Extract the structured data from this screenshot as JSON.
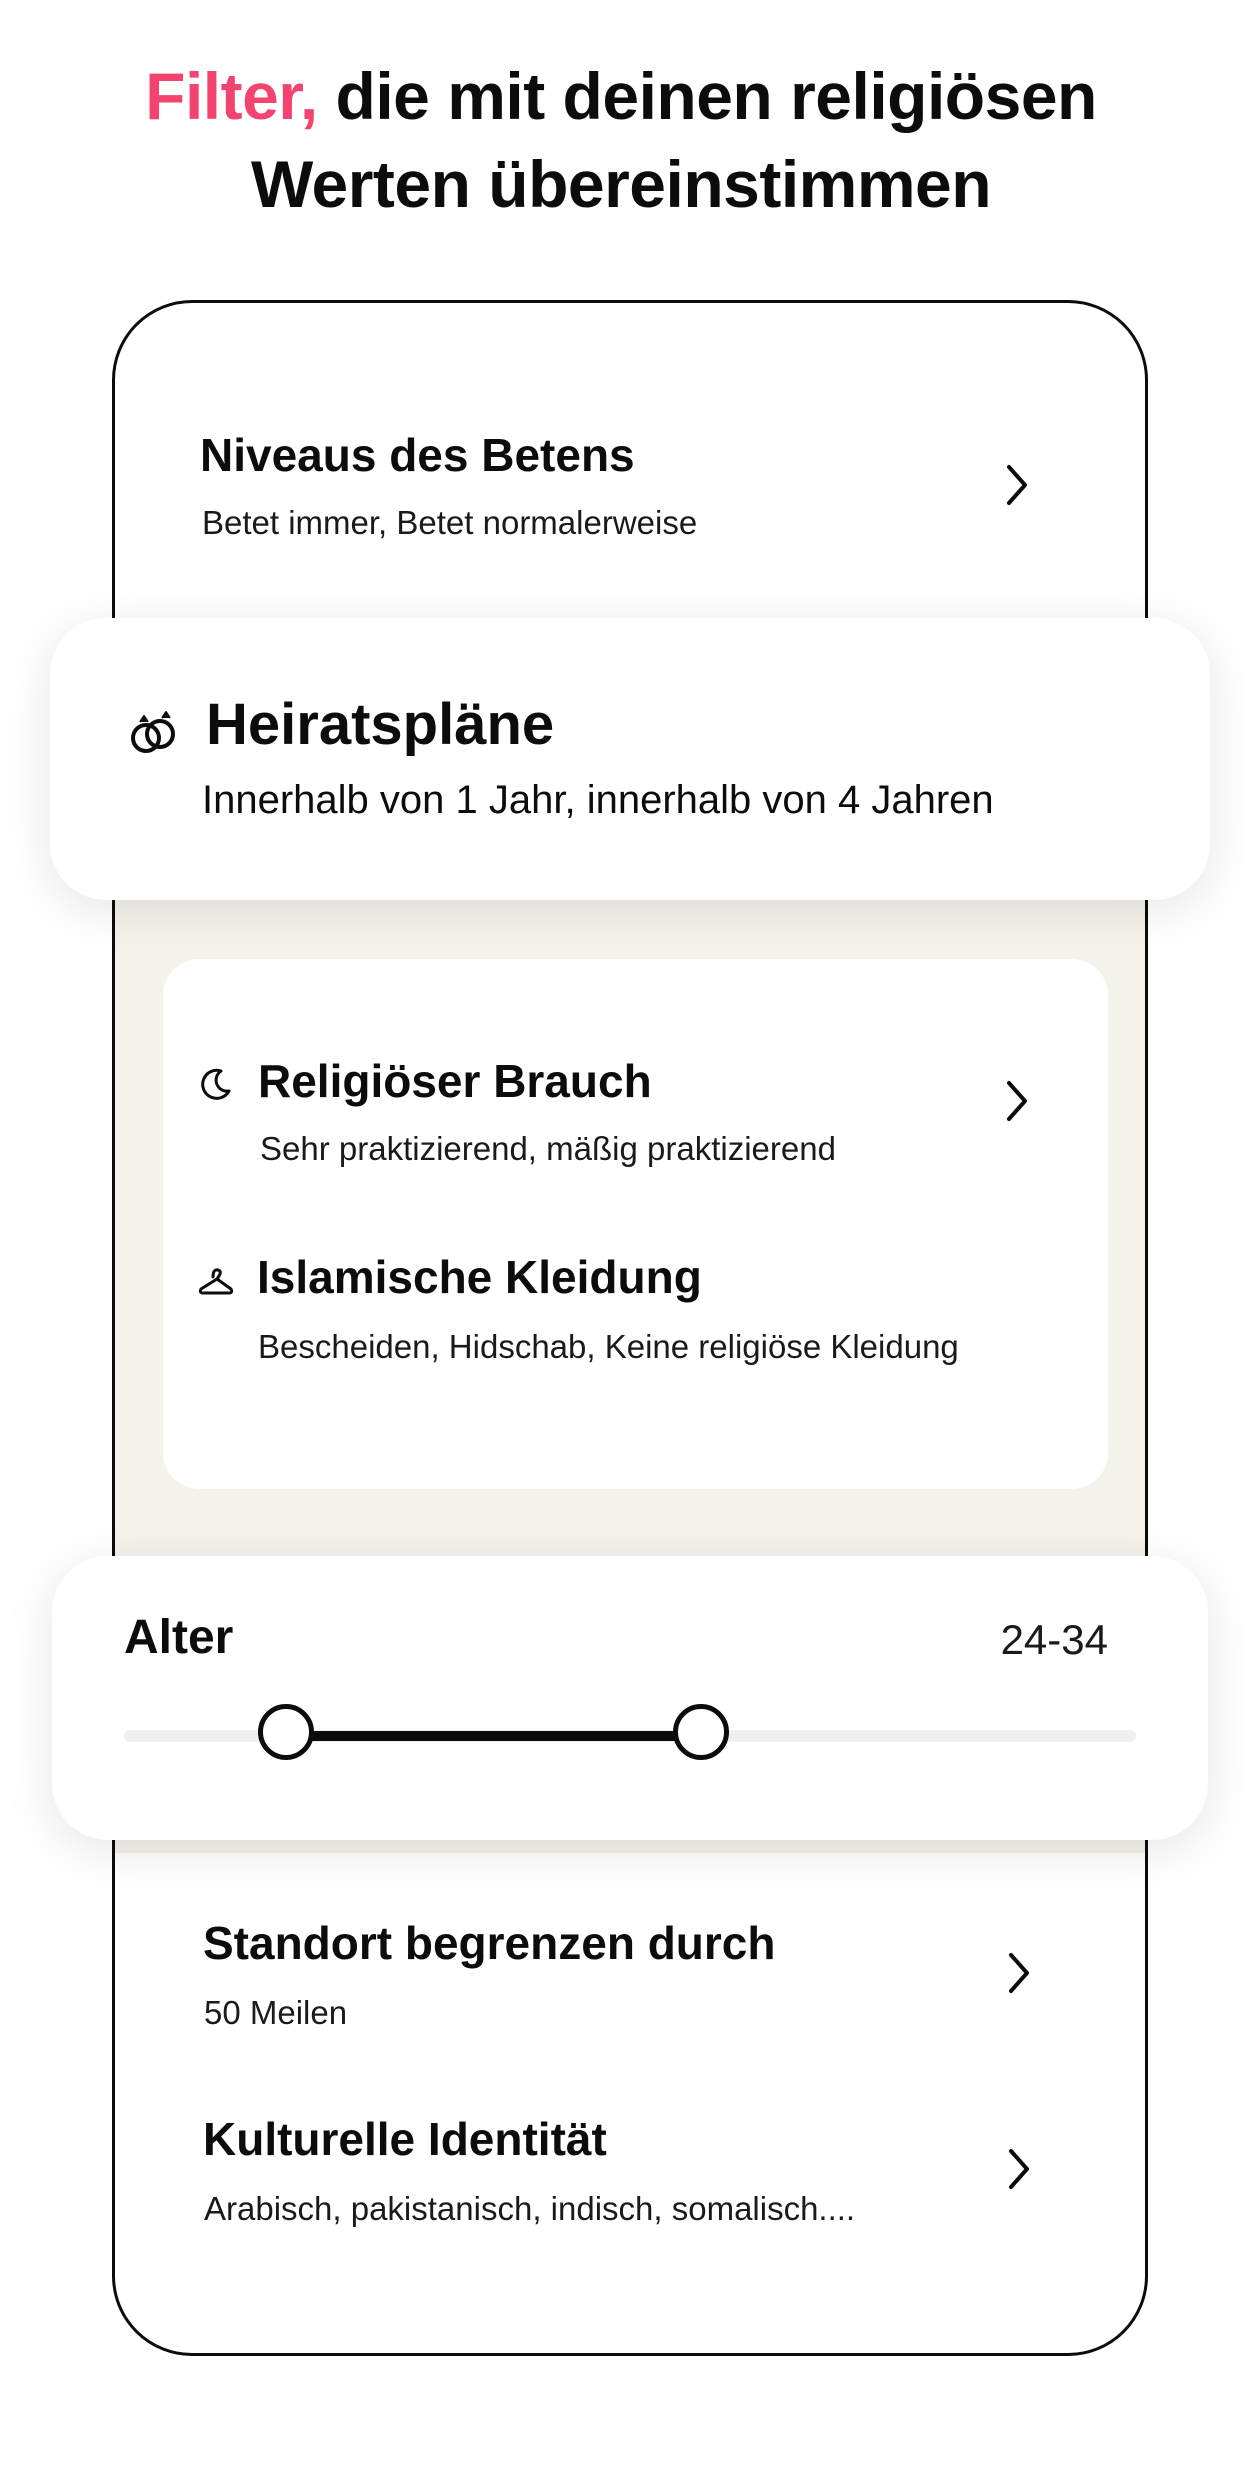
{
  "headline": {
    "accent": "Filter,",
    "line1_rest": " die mit deinen religiösen",
    "line2": "Werten übereinstimmen"
  },
  "colors": {
    "accent": "#f2446f",
    "text": "#0c0c0c",
    "section_background": "#f5f2ec",
    "slider_track": "#efefef"
  },
  "filters": {
    "prayer": {
      "title": "Niveaus des Betens",
      "subtitle": "Betet immer, Betet normalerweise",
      "icon": "chevron-right-icon"
    },
    "marriage": {
      "title": "Heiratspläne",
      "subtitle": "Innerhalb von 1 Jahr, innerhalb von 4 Jahren",
      "icon": "rings-icon"
    },
    "religious_practice": {
      "title": "Religiöser Brauch",
      "subtitle": "Sehr praktizierend, mäßig praktizierend",
      "icon": "moon-icon"
    },
    "islamic_clothing": {
      "title": "Islamische Kleidung",
      "subtitle": "Bescheiden, Hidschab, Keine religiöse Kleidung",
      "icon": "hanger-icon"
    },
    "age": {
      "label": "Alter",
      "value": "24-34",
      "range_start_fraction": 0.16,
      "range_end_fraction": 0.57
    },
    "location": {
      "title": "Standort begrenzen durch",
      "subtitle": "50 Meilen"
    },
    "culture": {
      "title": "Kulturelle Identität",
      "subtitle": "Arabisch, pakistanisch, indisch, somalisch...."
    }
  }
}
